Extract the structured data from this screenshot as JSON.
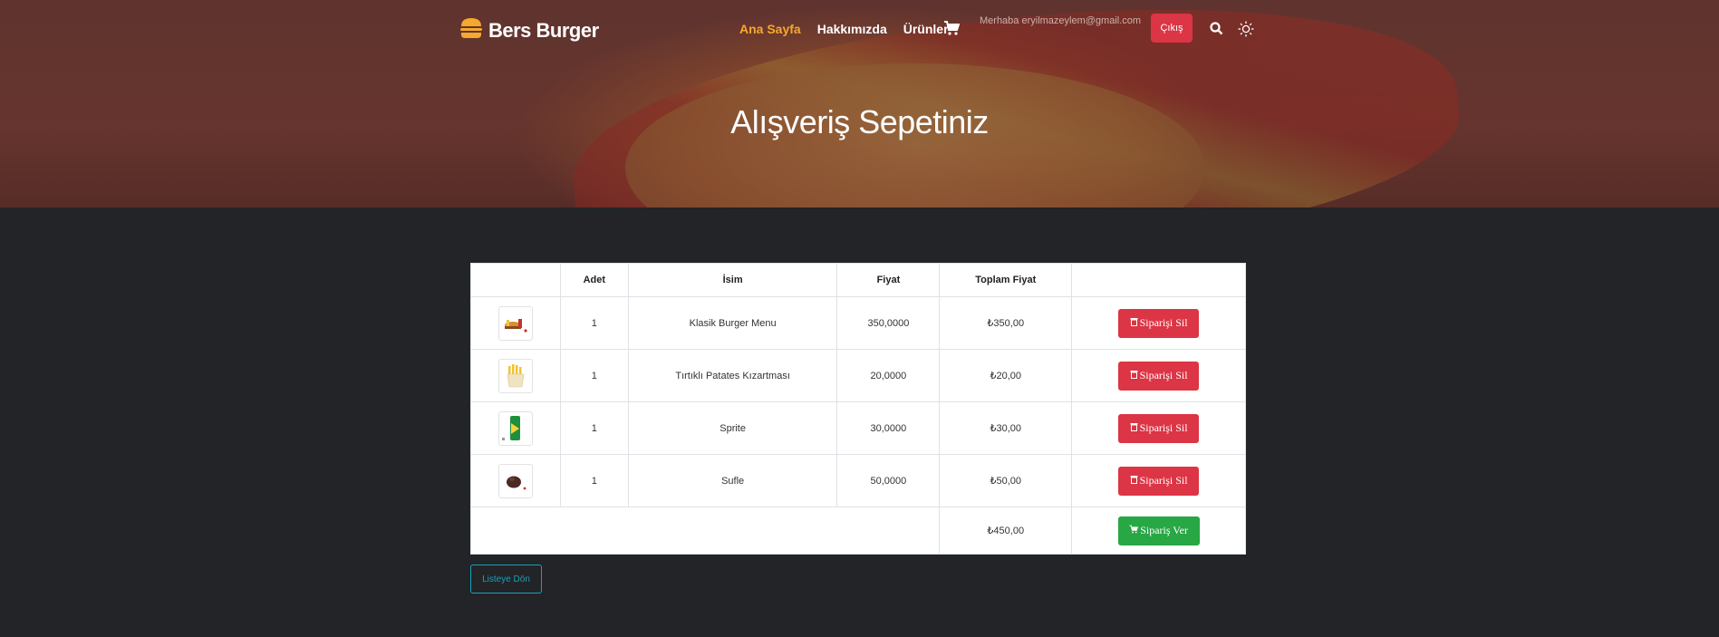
{
  "header": {
    "brand": "Bers Burger",
    "nav": [
      {
        "label": "Ana Sayfa",
        "active": true
      },
      {
        "label": "Hakkımızda",
        "active": false
      },
      {
        "label": "Ürünler",
        "active": false
      }
    ],
    "greeting": "Merhaba eryilmazeylem@gmail.com",
    "logout_label": "Çıkış",
    "icons": [
      "burger-logo-icon",
      "cart-icon",
      "search-icon",
      "sun-icon"
    ],
    "colors": {
      "active_link": "#f6a82d",
      "danger": "#dc3545",
      "success": "#28a745",
      "info": "#17a2b8"
    }
  },
  "page_title": "Alışveriş Sepetiniz",
  "table": {
    "headers": [
      "",
      "Adet",
      "İsim",
      "Fiyat",
      "Toplam Fiyat",
      ""
    ],
    "rows": [
      {
        "qty": "1",
        "name": "Klasik Burger Menu",
        "price": "350,0000",
        "total": "₺350,00",
        "thumb": "burger-menu-image"
      },
      {
        "qty": "1",
        "name": "Tırtıklı Patates Kızartması",
        "price": "20,0000",
        "total": "₺20,00",
        "thumb": "fries-image"
      },
      {
        "qty": "1",
        "name": "Sprite",
        "price": "30,0000",
        "total": "₺30,00",
        "thumb": "sprite-image"
      },
      {
        "qty": "1",
        "name": "Sufle",
        "price": "50,0000",
        "total": "₺50,00",
        "thumb": "sufle-image"
      }
    ],
    "delete_label": "Siparişi Sil",
    "grand_total": "₺450,00",
    "order_label": "Sipariş Ver"
  },
  "back_label": "Listeye Dön"
}
